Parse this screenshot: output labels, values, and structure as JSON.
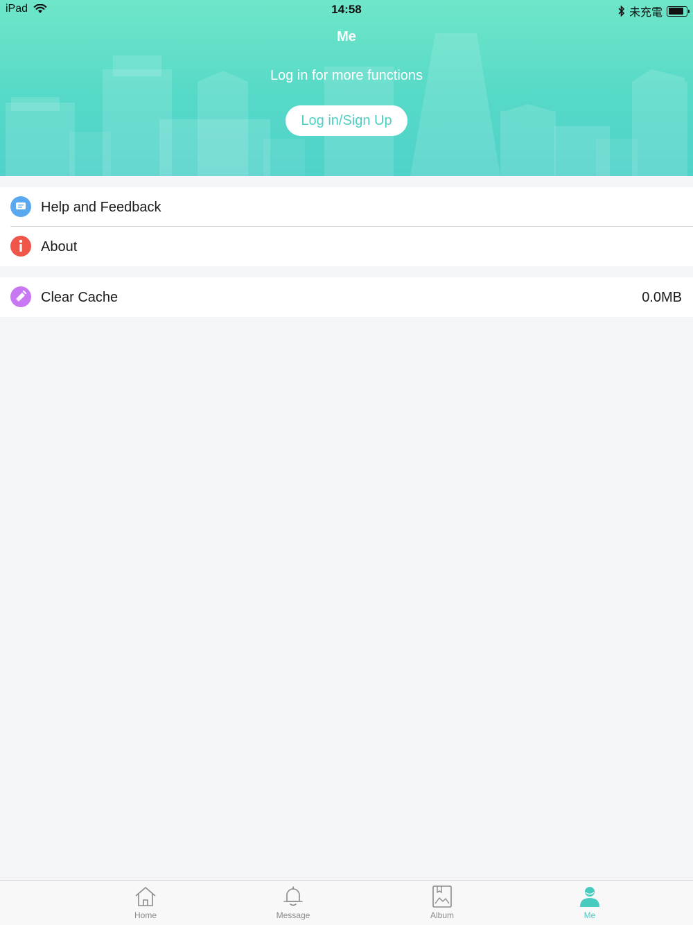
{
  "status_bar": {
    "device": "iPad",
    "time": "14:58",
    "charge_status": "未充電",
    "battery_level": 0.85
  },
  "header": {
    "title": "Me",
    "subtitle": "Log in for more functions",
    "login_button": "Log in/Sign Up"
  },
  "menu": {
    "help": {
      "label": "Help and Feedback",
      "icon": "chat-icon",
      "color": "#5aa9f0"
    },
    "about": {
      "label": "About",
      "icon": "info-icon",
      "color": "#f0554a"
    },
    "clear_cache": {
      "label": "Clear Cache",
      "value": "0.0MB",
      "icon": "broom-icon",
      "color": "#c778f2"
    }
  },
  "tabs": [
    {
      "label": "Home",
      "icon": "home-icon",
      "active": false
    },
    {
      "label": "Message",
      "icon": "bell-icon",
      "active": false
    },
    {
      "label": "Album",
      "icon": "album-icon",
      "active": false
    },
    {
      "label": "Me",
      "icon": "person-icon",
      "active": true
    }
  ],
  "colors": {
    "accent": "#48cbbf",
    "header_top": "#6fe6c9",
    "header_bottom": "#4fd2c9",
    "background": "#f3f5f9"
  }
}
